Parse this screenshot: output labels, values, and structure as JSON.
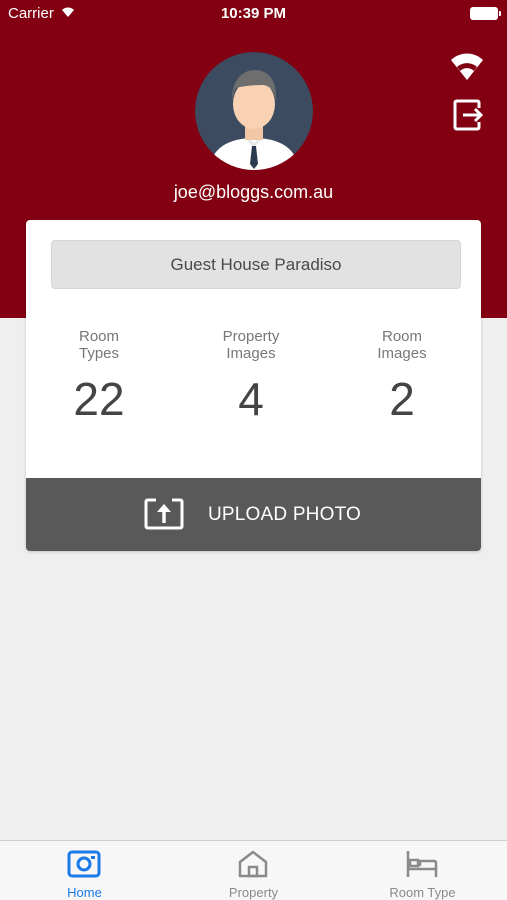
{
  "status_bar": {
    "carrier": "Carrier",
    "time": "10:39 PM"
  },
  "header": {
    "user_email": "joe@bloggs.com.au",
    "background_color": "#820012",
    "icons": [
      "wifi-icon",
      "logout-icon"
    ]
  },
  "card": {
    "property_name": "Guest House Paradiso",
    "stats": [
      {
        "label_line1": "Room",
        "label_line2": "Types",
        "value": "22"
      },
      {
        "label_line1": "Property",
        "label_line2": "Images",
        "value": "4"
      },
      {
        "label_line1": "Room",
        "label_line2": "Images",
        "value": "2"
      }
    ],
    "upload_label": "UPLOAD PHOTO"
  },
  "tab_bar": {
    "active_color": "#1a7ae6",
    "tabs": [
      {
        "label": "Home",
        "icon": "camera-icon",
        "active": true
      },
      {
        "label": "Property",
        "icon": "house-icon",
        "active": false
      },
      {
        "label": "Room Type",
        "icon": "bed-icon",
        "active": false
      }
    ]
  }
}
